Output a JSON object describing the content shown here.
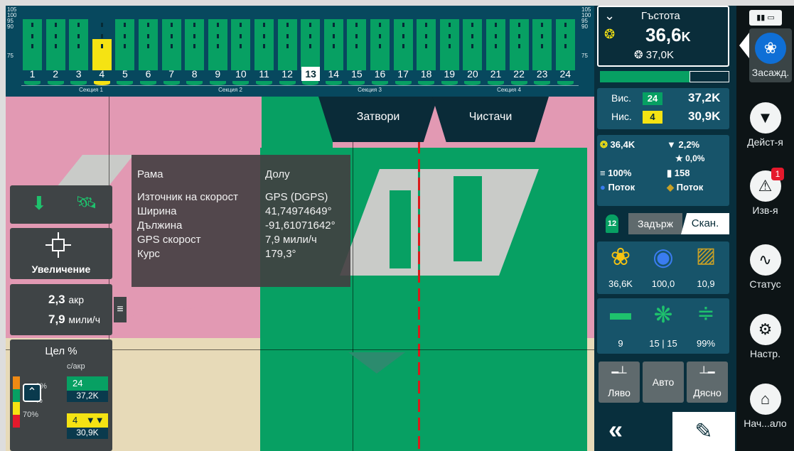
{
  "section_bar": {
    "scale_top": [
      "105",
      "100",
      "95",
      "90"
    ],
    "scale_75": "75",
    "rows": [
      "1",
      "2",
      "3",
      "4",
      "5",
      "6",
      "7",
      "8",
      "9",
      "10",
      "11",
      "12",
      "13",
      "14",
      "15",
      "16",
      "17",
      "18",
      "19",
      "20",
      "21",
      "22",
      "23",
      "24"
    ],
    "highlighted_row": "4",
    "selected_row": "13",
    "sections": [
      "Секция 1",
      "Секция 2",
      "Секция 3",
      "Секция 4"
    ]
  },
  "tabs": {
    "shutters": "Затвори",
    "cleaners": "Чистачи"
  },
  "info_popup": {
    "frame_label": "Рама",
    "frame_value": "Долу",
    "rows": [
      {
        "k": "Източник на скорост",
        "v": "GPS (DGPS)"
      },
      {
        "k": "Ширина",
        "v": "41,74974649°"
      },
      {
        "k": "Дължина",
        "v": "-91,61071642°"
      },
      {
        "k": "GPS скорост",
        "v": "7,9 мили/ч"
      },
      {
        "k": "Курс",
        "v": "179,3°"
      }
    ]
  },
  "left_controls": {
    "zoom_label": "Увеличение",
    "area_value": "2,3",
    "area_unit": "акр",
    "speed_value": "7,9",
    "speed_unit": "мили/ч",
    "goal_title": "Цел %",
    "goal_unit": "с/акр",
    "goal_pct_top": "0%",
    "goal_pct_mid": "%",
    "goal_pct_low": "70%",
    "high_row": "24",
    "high_value": "37,2K",
    "low_row": "4",
    "low_value": "30,9K"
  },
  "right_panel": {
    "density_title": "Гъстота",
    "density_value": "36,6",
    "density_unit": "K",
    "density_target": "37,0K",
    "high_label": "Вис.",
    "high_row": "24",
    "high_value": "37,2K",
    "low_label": "Нис.",
    "low_row": "4",
    "low_value": "30,9K",
    "m_seed": "36,4K",
    "m_skips": "2,2%",
    "m_doubles": "0,0%",
    "m_singulation": "100%",
    "m_count": "158",
    "m_flow1": "Поток",
    "m_flow2": "Поток",
    "scan_row": "12",
    "hold_label": "Задърж",
    "scan_label": "Скан.",
    "icons1_values": [
      "36,6K",
      "100,0",
      "10,9"
    ],
    "icons2_v1": "9",
    "icons2_v2a": "15",
    "icons2_v2b": "15",
    "icons2_v3": "99%",
    "side_left": "Ляво",
    "side_auto": "Авто",
    "side_right": "Дясно"
  },
  "nav": {
    "items": [
      {
        "label": "Засажд.",
        "icon": "planting-icon"
      },
      {
        "label": "Дейст-я",
        "icon": "actions-icon"
      },
      {
        "label": "Изв-я",
        "icon": "alerts-icon",
        "badge": "1"
      },
      {
        "label": "Статус",
        "icon": "status-icon"
      },
      {
        "label": "Настр.",
        "icon": "settings-icon"
      },
      {
        "label": "Нач...ало",
        "icon": "home-icon"
      }
    ]
  },
  "colors": {
    "accent_green": "#07a063",
    "yellow": "#f5e313",
    "panel_blue": "#17546a",
    "alert_red": "#e5192c"
  }
}
